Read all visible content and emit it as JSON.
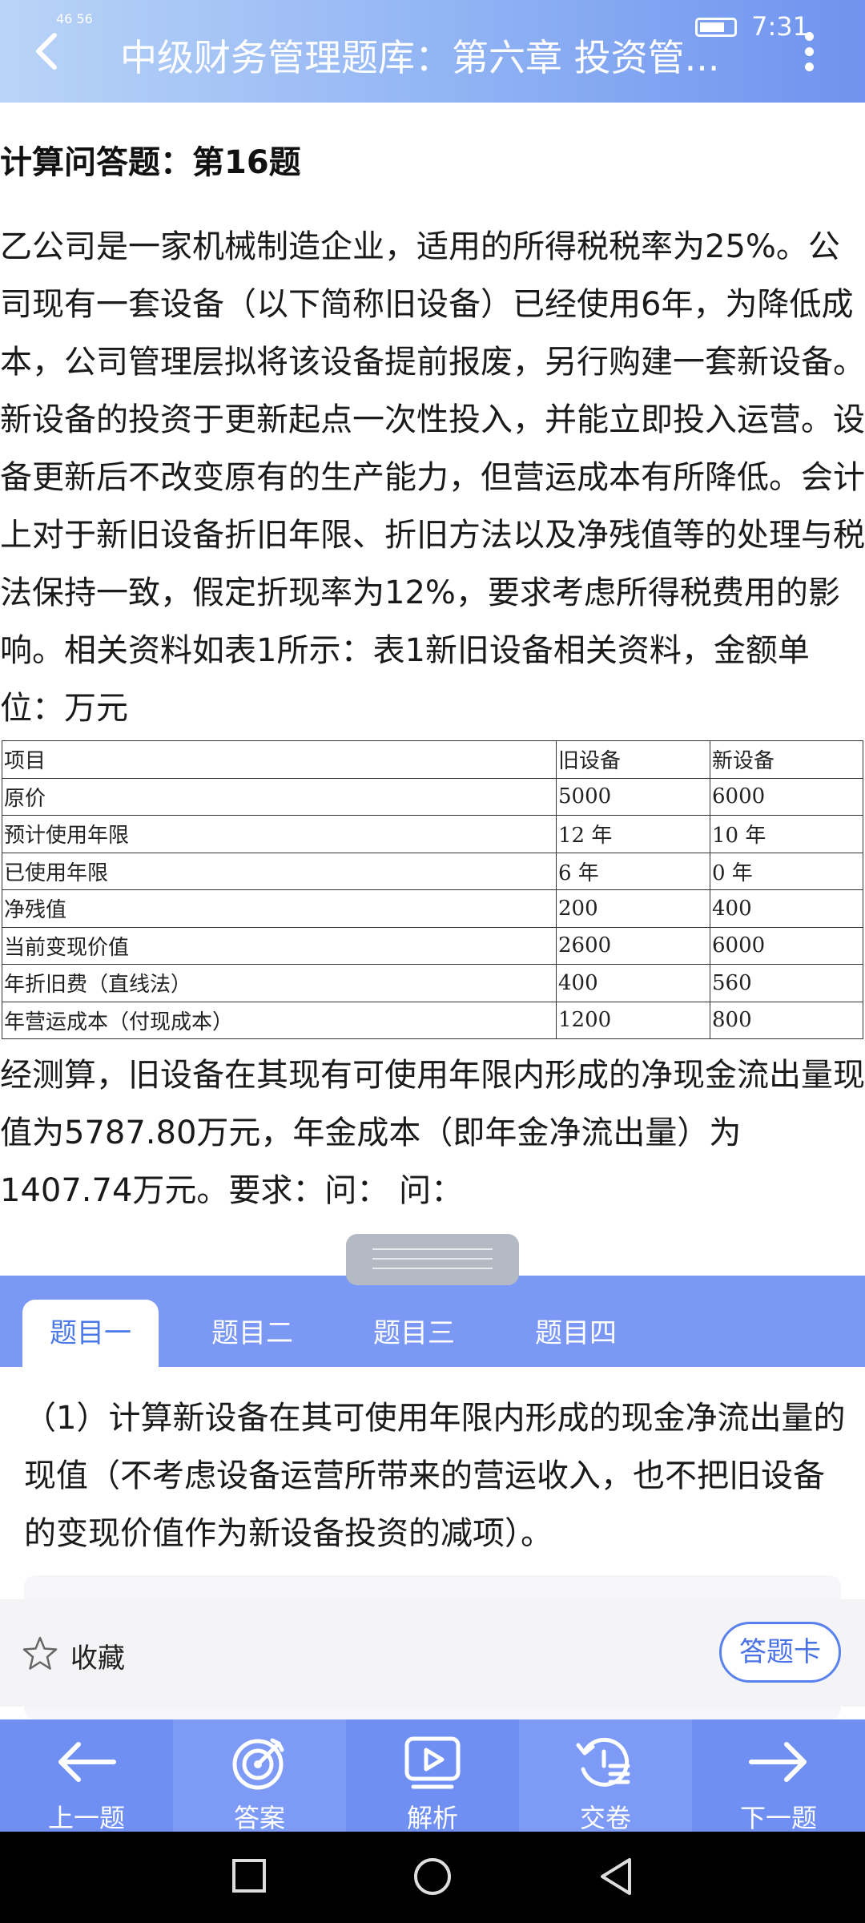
{
  "status_bar": {
    "signal": "46 56",
    "time": "7:31"
  },
  "header": {
    "title": "中级财务管理题库：第六章 投资管..."
  },
  "question": {
    "heading": "计算问答题：第16题",
    "body": "乙公司是一家机械制造企业，适用的所得税税率为25%。公司现有一套设备（以下简称旧设备）已经使用6年，为降低成本，公司管理层拟将该设备提前报废，另行购建一套新设备。新设备的投资于更新起点一次性投入，并能立即投入运营。设备更新后不改变原有的生产能力，但营运成本有所降低。会计上对于新旧设备折旧年限、折旧方法以及净残值等的处理与税法保持一致，假定折现率为12%，要求考虑所得税费用的影响。相关资料如表1所示：表1新旧设备相关资料，金额单位：万元",
    "table": {
      "headers": [
        "项目",
        "旧设备",
        "新设备"
      ],
      "rows": [
        [
          "原价",
          "5000",
          "6000"
        ],
        [
          "预计使用年限",
          "12 年",
          "10 年"
        ],
        [
          "已使用年限",
          "6 年",
          "0 年"
        ],
        [
          "净残值",
          "200",
          "400"
        ],
        [
          "当前变现价值",
          "2600",
          "6000"
        ],
        [
          "年折旧费（直线法）",
          "400",
          "560"
        ],
        [
          "年营运成本（付现成本）",
          "1200",
          "800"
        ]
      ]
    },
    "body2": "经测算，旧设备在其现有可使用年限内形成的净现金流出量现值为5787.80万元，年金成本（即年金净流出量）为1407.74万元。要求：问： 问："
  },
  "tabs": [
    "题目一",
    "题目二",
    "题目三",
    "题目四"
  ],
  "sub_question": "（1）计算新设备在其可使用年限内形成的现金净流出量的现值（不考虑设备运营所带来的营运收入，也不把旧设备的变现价值作为新设备投资的减项）。",
  "favorite": {
    "label": "收藏",
    "card_button": "答题卡"
  },
  "bottom_nav": [
    {
      "label": "上一题",
      "icon": "arrow-left-icon"
    },
    {
      "label": "答案",
      "icon": "target-icon"
    },
    {
      "label": "解析",
      "icon": "video-play-icon"
    },
    {
      "label": "交卷",
      "icon": "submit-icon"
    },
    {
      "label": "下一题",
      "icon": "arrow-right-icon"
    }
  ],
  "colors": {
    "primary": "#6f8ff3",
    "active_tab_text": "#4a78e8",
    "header_start": "#b9d4f7"
  }
}
